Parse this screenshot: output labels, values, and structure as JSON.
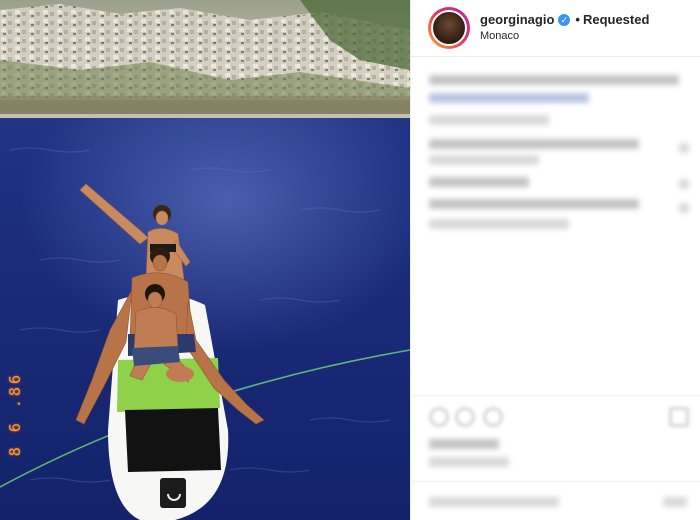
{
  "post": {
    "username": "georginagio",
    "verified_mark": "✓",
    "separator": "•",
    "follow_status": "Requested",
    "location": "Monaco",
    "photo_date_stamp": "8 6 .86"
  },
  "icons": {
    "verified": "verified-badge-icon",
    "like": "heart-icon",
    "comment": "comment-icon",
    "share": "share-icon",
    "save": "bookmark-icon"
  },
  "colors": {
    "verified_blue": "#3897f0",
    "date_stamp": "#ff9a2e",
    "sea": "#1b2f7a",
    "board_green": "#8fd24a"
  }
}
